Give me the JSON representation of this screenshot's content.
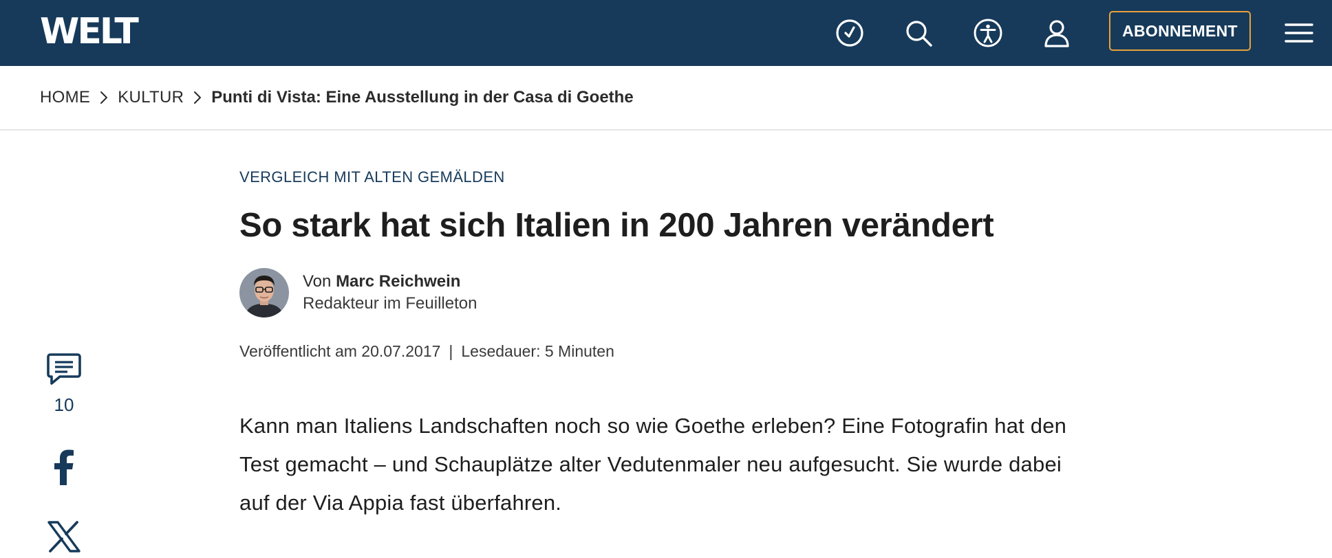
{
  "header": {
    "logo": "WELT",
    "subscribe_label": "ABONNEMENT",
    "icons": [
      "clock-icon",
      "search-icon",
      "accessibility-icon",
      "user-icon",
      "menu-icon"
    ],
    "colors": {
      "background": "#173a5a",
      "accent": "#e9a23b"
    }
  },
  "breadcrumb": {
    "items": [
      "HOME",
      "KULTUR",
      "Punti di Vista: Eine Ausstellung in der Casa di Goethe"
    ]
  },
  "social": {
    "comment_count": "10",
    "icons": [
      "comment-icon",
      "facebook-icon",
      "x-icon"
    ]
  },
  "article": {
    "kicker": "VERGLEICH MIT ALTEN GEMÄLDEN",
    "headline": "So stark hat sich Italien in 200 Jahren verändert",
    "author_prefix": "Von",
    "author_name": "Marc Reichwein",
    "author_role": "Redakteur im Feuilleton",
    "published": "Veröffentlicht am 20.07.2017",
    "separator": "|",
    "reading_time": "Lesedauer: 5 Minuten",
    "intro": "Kann man Italiens Landschaften noch so wie Goethe erleben? Eine Fotografin hat den Test gemacht – und Schauplätze alter Vedutenmaler neu aufgesucht. Sie wurde dabei auf der Via Appia fast überfahren."
  }
}
